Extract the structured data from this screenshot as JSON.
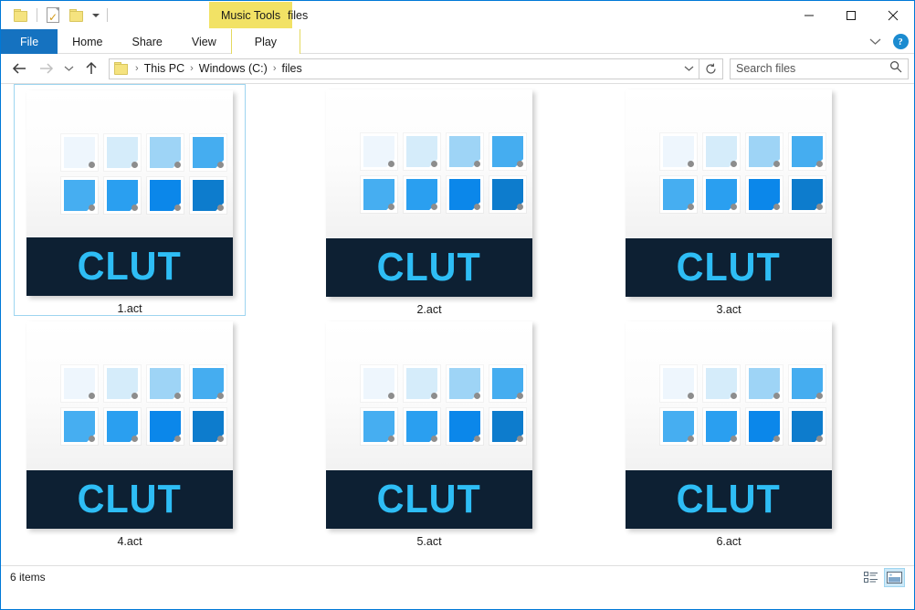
{
  "window": {
    "title": "files",
    "contextual_tools": "Music Tools"
  },
  "quick_access": {
    "items": [
      {
        "name": "folder-icon",
        "label": "Folder"
      },
      {
        "name": "properties-icon",
        "label": "Properties"
      },
      {
        "name": "new-folder-icon",
        "label": "New folder"
      },
      {
        "name": "customize-dropdown-icon",
        "label": "Customize Quick Access Toolbar"
      }
    ]
  },
  "window_controls": {
    "minimize": "Minimize",
    "maximize": "Maximize",
    "close": "Close"
  },
  "ribbon": {
    "tabs": [
      {
        "label": "File",
        "active": true
      },
      {
        "label": "Home",
        "active": false
      },
      {
        "label": "Share",
        "active": false
      },
      {
        "label": "View",
        "active": false
      },
      {
        "label": "Play",
        "active": false,
        "contextual": true
      }
    ],
    "collapse_label": "Minimize the Ribbon",
    "help_label": "?"
  },
  "navigation": {
    "back": "Back",
    "forward": "Forward",
    "recent": "Recent locations",
    "up": "Up"
  },
  "breadcrumb": {
    "items": [
      "This PC",
      "Windows (C:)",
      "files"
    ],
    "separator": "›",
    "dropdown_label": "Previous locations",
    "refresh_label": "Refresh"
  },
  "search": {
    "placeholder": "Search files",
    "value": "",
    "icon": "search-icon"
  },
  "files": [
    {
      "name": "1.act",
      "selected": true,
      "banner_text": "CLUT"
    },
    {
      "name": "2.act",
      "selected": false,
      "banner_text": "CLUT"
    },
    {
      "name": "3.act",
      "selected": false,
      "banner_text": "CLUT"
    },
    {
      "name": "4.act",
      "selected": false,
      "banner_text": "CLUT"
    },
    {
      "name": "5.act",
      "selected": false,
      "banner_text": "CLUT"
    },
    {
      "name": "6.act",
      "selected": false,
      "banner_text": "CLUT"
    }
  ],
  "icon_palette": {
    "swatches": [
      "#eef6fd",
      "#d5ecfa",
      "#9ed4f6",
      "#45adf0",
      "#46aef1",
      "#2a9ff0",
      "#0b87ea",
      "#0d7ccd"
    ],
    "banner_bg": "#0d2033",
    "banner_fg": "#2ebdf5"
  },
  "status": {
    "item_count": "6 items",
    "views": [
      {
        "name": "details-view-button",
        "label": "Details view",
        "active": false
      },
      {
        "name": "large-icons-view-button",
        "label": "Large icons view",
        "active": true
      }
    ]
  },
  "colors": {
    "accent": "#0078d7",
    "file_tab": "#1572c0",
    "contextual": "#f2e265",
    "selection_border": "#9ed5f0"
  }
}
